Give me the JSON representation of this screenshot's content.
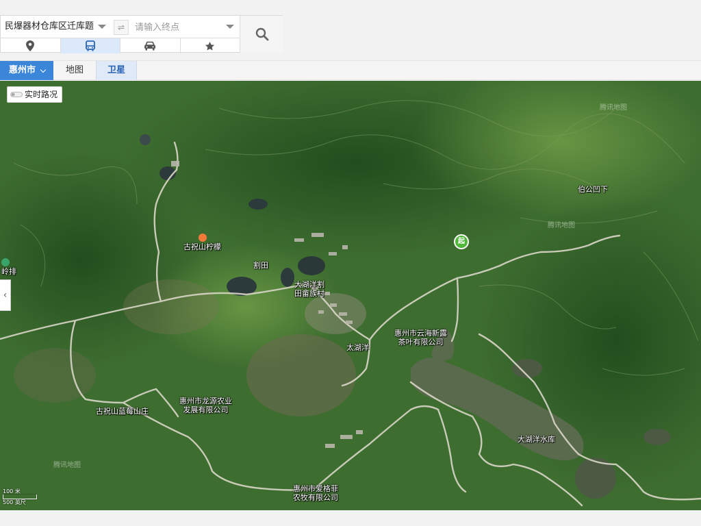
{
  "route": {
    "start_value": "民爆器材仓库区迁库题",
    "swap_symbol": "⇌",
    "end_placeholder": "请输入终点",
    "modes": [
      "location-icon",
      "bus-icon",
      "car-icon",
      "star-icon"
    ],
    "active_mode": "bus"
  },
  "map_bar": {
    "city": "惠州市",
    "tabs": {
      "map": "地图",
      "satellite": "卫星"
    },
    "active_tab": "satellite"
  },
  "map": {
    "traffic_label": "实时路况",
    "start_marker": "起",
    "watermark": "腾讯地图",
    "scale_top": "100 米",
    "scale_bottom": "500 英尺",
    "labels": {
      "bogong": "伯公凹下",
      "guzhu_lemon": "古祝山柠檬",
      "getian": "割田",
      "dahuyang_village_1": "大湖洋割",
      "dahuyang_village_2": "田畲族村",
      "lingpai": "岭排",
      "yunhai_1": "惠州市云海新露",
      "yunhai_2": "茶叶有限公司",
      "dahuyang": "太湖洋",
      "longyuan_1": "惠州市龙源农业",
      "longyuan_2": "发展有限公司",
      "blueberry": "古祝山蓝莓山庄",
      "reservoir": "大湖洋水库",
      "aigefei_1": "惠州市爱格菲",
      "aigefei_2": "农牧有限公司"
    }
  },
  "colors": {
    "accent": "#3b86d8",
    "start_green": "#4fb83a",
    "poi_orange": "#f07a3a"
  }
}
